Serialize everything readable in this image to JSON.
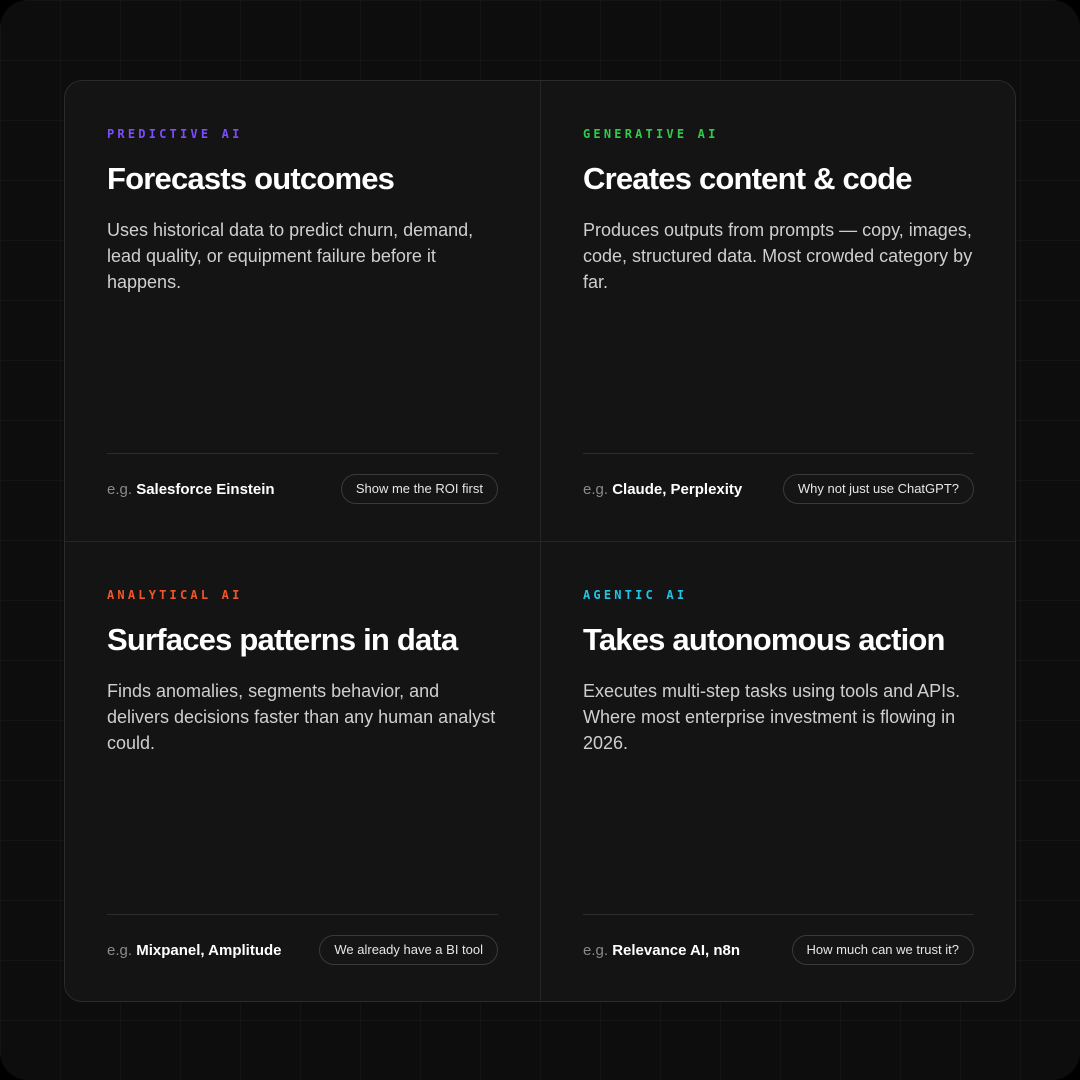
{
  "colors": {
    "predictive": "#7c4dff",
    "generative": "#2ecc4a",
    "analytical": "#f0552b",
    "agentic": "#22c4e6"
  },
  "cards": [
    {
      "eyebrow": "PREDICTIVE AI",
      "title": "Forecasts outcomes",
      "description": "Uses historical data to predict churn, demand, lead quality, or equipment failure before it happens.",
      "example_prefix": "e.g.",
      "example_names": "Salesforce Einstein",
      "pill": "Show me the ROI first"
    },
    {
      "eyebrow": "GENERATIVE AI",
      "title": "Creates content & code",
      "description": "Produces outputs from prompts — copy, images, code, structured data. Most crowded category by far.",
      "example_prefix": "e.g.",
      "example_names": "Claude, Perplexity",
      "pill": "Why not just use ChatGPT?"
    },
    {
      "eyebrow": "ANALYTICAL AI",
      "title": "Surfaces patterns in data",
      "description": "Finds anomalies, segments behavior, and delivers decisions faster than any human analyst could.",
      "example_prefix": "e.g.",
      "example_names": "Mixpanel, Amplitude",
      "pill": "We already have a BI tool"
    },
    {
      "eyebrow": "AGENTIC AI",
      "title": "Takes autonomous action",
      "description": "Executes multi-step tasks using tools and APIs. Where most enterprise investment is flowing in 2026.",
      "example_prefix": "e.g.",
      "example_names": "Relevance AI, n8n",
      "pill": "How much can we trust it?"
    }
  ]
}
